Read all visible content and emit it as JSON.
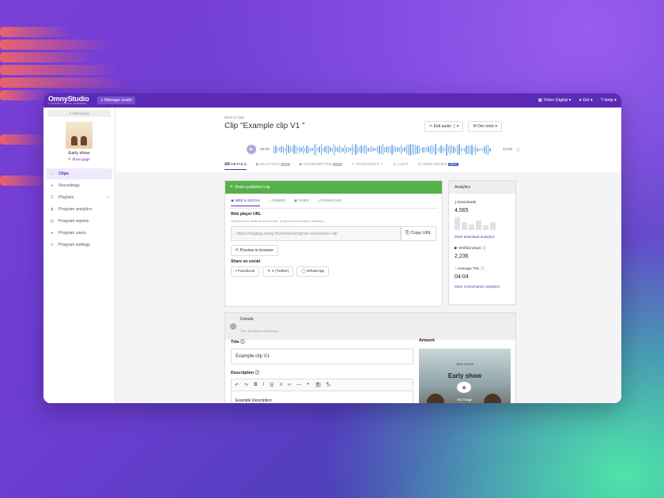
{
  "topbar": {
    "logo": "OmnyStudio",
    "logo_sub": "A TRITON DIGITAL COMPANY",
    "manage_audio": "Manage audio",
    "org": "Triton Digital",
    "user": "Del",
    "help": "Help"
  },
  "sidebar": {
    "program_tag": "PROGRAM",
    "program_name": "Early show",
    "show_page": "Show page",
    "items": [
      {
        "label": "Clips",
        "icon": "music-icon"
      },
      {
        "label": "Recordings",
        "icon": "mic-icon"
      },
      {
        "label": "Playlists",
        "icon": "list-icon"
      },
      {
        "label": "Program analytics",
        "icon": "chart-icon"
      },
      {
        "label": "Program reports",
        "icon": "report-icon"
      },
      {
        "label": "Program users",
        "icon": "user-icon"
      },
      {
        "label": "Program settings",
        "icon": "gear-icon"
      }
    ]
  },
  "header": {
    "back": "Back to clips",
    "title": "Clip \"Example clip V1 \"",
    "edit_audio": "Edit audio",
    "dev_tools": "Dev tools"
  },
  "player": {
    "start": "00:00",
    "end": "14:00"
  },
  "tabs": [
    {
      "label": "DETAILS"
    },
    {
      "label": "ANALYTICS",
      "badge": "4.5K"
    },
    {
      "label": "CONSUMPTION",
      "badge": "2.2K"
    },
    {
      "label": "TRANSCRIPT"
    },
    {
      "label": "AUDIT"
    },
    {
      "label": "FEED DROPS",
      "badge": "NEW"
    }
  ],
  "share": {
    "header": "Share published clip",
    "tabs": [
      "WEB & SOCIAL",
      "EMBED",
      "VIDEO",
      "DOWNLOAD"
    ],
    "web_player_label": "Web player URL",
    "web_player_sub": "Optimized for desktop and mobile. Supports consumption analytics.",
    "url": "https://staging.omny.fm/shows/program-a/example-clip",
    "copy": "Copy URL",
    "preview": "Preview in browser",
    "social_label": "Share on social",
    "facebook": "Facebook",
    "twitter": "X (Twitter)",
    "whatsapp": "WhatsApp"
  },
  "analytics": {
    "header": "Analytics",
    "downloads_label": "Downloads",
    "downloads": "4,565",
    "downloads_link": "More download analytics",
    "plays_label": "Verified plays",
    "plays": "2,236",
    "tsl_label": "Average TSL",
    "tsl": "04:04",
    "consumption_link": "More consumption analytics"
  },
  "details": {
    "header": "Details",
    "sub": "Title, description and artwork",
    "title_label": "Title",
    "title_value": "Example clip V1",
    "description_label": "Description",
    "description_value": "Example Description",
    "artwork_label": "Artwork",
    "art_caption": "TAKE A STEP",
    "art_title": "Early show",
    "no_image": "No image"
  }
}
